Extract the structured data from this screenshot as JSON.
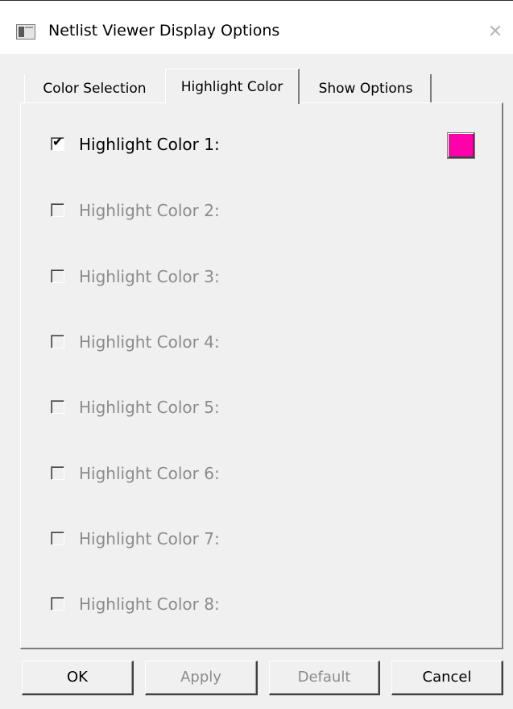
{
  "window": {
    "title": "Netlist Viewer Display Options",
    "close_glyph": "✕"
  },
  "tabs": [
    {
      "label": "Color Selection",
      "active": false
    },
    {
      "label": "Highlight Color",
      "active": true
    },
    {
      "label": "Show Options",
      "active": false
    }
  ],
  "highlight_colors": [
    {
      "label": "Highlight Color 1:",
      "checked": true,
      "enabled": true,
      "color": "#ff00aa"
    },
    {
      "label": "Highlight Color 2:",
      "checked": false,
      "enabled": false
    },
    {
      "label": "Highlight Color 3:",
      "checked": false,
      "enabled": false
    },
    {
      "label": "Highlight Color 4:",
      "checked": false,
      "enabled": false
    },
    {
      "label": "Highlight Color 5:",
      "checked": false,
      "enabled": false
    },
    {
      "label": "Highlight Color 6:",
      "checked": false,
      "enabled": false
    },
    {
      "label": "Highlight Color 7:",
      "checked": false,
      "enabled": false
    },
    {
      "label": "Highlight Color 8:",
      "checked": false,
      "enabled": false
    }
  ],
  "check_glyph": "✔",
  "buttons": {
    "ok": {
      "label": "OK",
      "enabled": true
    },
    "apply": {
      "label": "Apply",
      "enabled": false
    },
    "default": {
      "label": "Default",
      "enabled": false
    },
    "cancel": {
      "label": "Cancel",
      "enabled": true
    }
  }
}
